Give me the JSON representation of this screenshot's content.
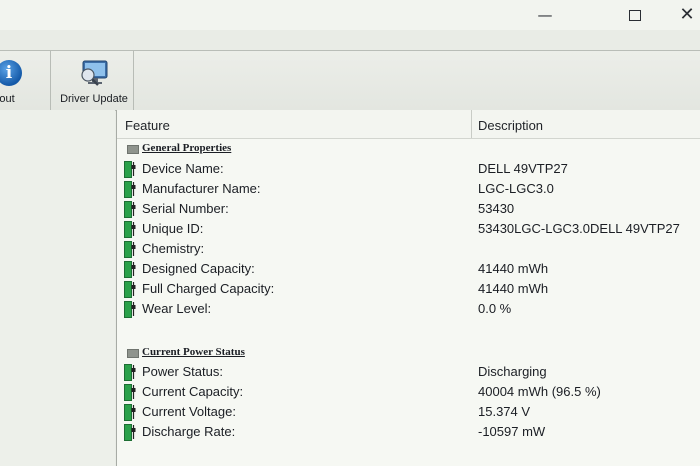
{
  "window": {
    "minimize_icon": "minimize-icon",
    "maximize_icon": "maximize-icon",
    "close_icon": "close-icon",
    "close_glyph": "✕",
    "minimize_glyph": "—"
  },
  "toolbar": {
    "about_label": "bout",
    "driver_update_label": "Driver Update",
    "info_glyph": "i"
  },
  "list": {
    "columns": {
      "feature": "Feature",
      "description": "Description"
    },
    "sections": [
      {
        "title": "General Properties",
        "rows": [
          {
            "feature": "Device Name:",
            "value": "DELL 49VTP27"
          },
          {
            "feature": "Manufacturer Name:",
            "value": "LGC-LGC3.0"
          },
          {
            "feature": "Serial Number:",
            "value": "53430"
          },
          {
            "feature": "Unique ID:",
            "value": "53430LGC-LGC3.0DELL 49VTP27"
          },
          {
            "feature": "Chemistry:",
            "value": ""
          },
          {
            "feature": "Designed Capacity:",
            "value": "41440 mWh"
          },
          {
            "feature": "Full Charged Capacity:",
            "value": "41440 mWh"
          },
          {
            "feature": "Wear Level:",
            "value": "0.0 %"
          }
        ]
      },
      {
        "title": "Current Power Status",
        "rows": [
          {
            "feature": "Power Status:",
            "value": "Discharging"
          },
          {
            "feature": "Current Capacity:",
            "value": "40004 mWh (96.5 %)"
          },
          {
            "feature": "Current Voltage:",
            "value": "15.374 V"
          },
          {
            "feature": "Discharge Rate:",
            "value": "-10597 mW"
          }
        ]
      }
    ]
  },
  "colors": {
    "battery_green": "#2ba14a",
    "info_blue": "#1459a8"
  }
}
